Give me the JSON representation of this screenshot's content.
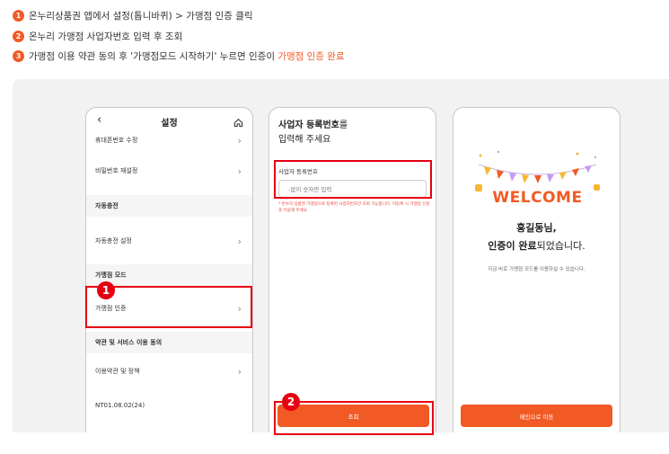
{
  "steps": [
    {
      "num": "1",
      "text": "온누리상품권 앱에서 설정(톱니바퀴) > 가맹점 인증 클릭",
      "highlight": ""
    },
    {
      "num": "2",
      "text": "온누리 가맹점 사업자번호 입력 후 조회",
      "highlight": ""
    },
    {
      "num": "3",
      "text": "가맹점 이용 약관 동의 후 '가맹점모드 시작하기' 누르면 인증이 ",
      "highlight": "가맹점 인증 완료"
    }
  ],
  "phone1": {
    "back_icon": "back-arrow-icon",
    "title": "설정",
    "home_icon": "home-icon",
    "rows": [
      {
        "label": "휴대폰번호 수정"
      },
      {
        "label": "비밀번호 재설정"
      },
      {
        "label": "자동충전 설정"
      },
      {
        "label": "가맹점 인증"
      },
      {
        "label": "이용약관 및 정책"
      },
      {
        "label": "NT01.08.02(24)"
      }
    ],
    "sections": [
      "자동충전",
      "가맹점 모드",
      "약관 및 서비스 이용 동의"
    ]
  },
  "phone2": {
    "title_bold": "사업자 등록번호",
    "title_rest": "를",
    "title_line2": "입력해 주세요",
    "field_label": "사업자 등록번호",
    "field_placeholder": "-없이 숫자만 입력",
    "note": "* 온누리 상품권 가맹점으로 등록된 사업자번호만 조회 가능합니다. 미등록 시 가맹점 신청 후 이용해 주세요.",
    "button": "조회"
  },
  "phone3": {
    "welcome": "WELCOME",
    "name": "홍길동님,",
    "done_bold": "인증이 완료",
    "done_rest": "되었습니다.",
    "sub": "지금 바로 가맹점 모드를 이용하실 수 있습니다.",
    "button": "메인으로 이동"
  },
  "markers": [
    "1",
    "2"
  ],
  "colors": {
    "accent": "#f15a24",
    "highlight_box": "#e60012",
    "panel_bg": "#f2f2f2"
  }
}
